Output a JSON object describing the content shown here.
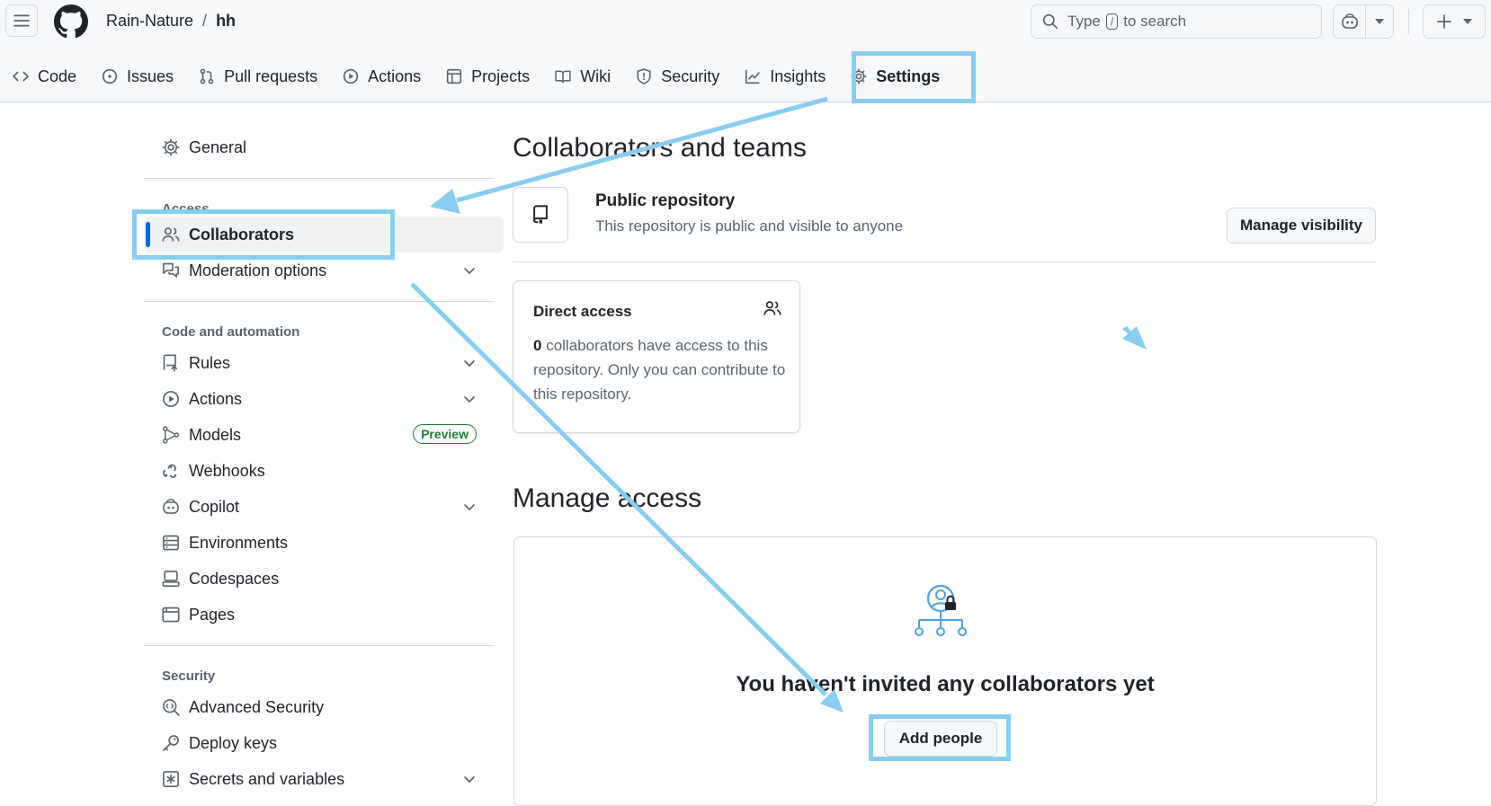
{
  "header": {
    "owner": "Rain-Nature",
    "separator": "/",
    "repo": "hh",
    "search_prefix": "Type",
    "search_key": "/",
    "search_suffix": "to search"
  },
  "tabs": [
    {
      "label": "Code",
      "icon": "code-icon"
    },
    {
      "label": "Issues",
      "icon": "issue-opened-icon"
    },
    {
      "label": "Pull requests",
      "icon": "git-pull-request-icon"
    },
    {
      "label": "Actions",
      "icon": "play-icon"
    },
    {
      "label": "Projects",
      "icon": "table-icon"
    },
    {
      "label": "Wiki",
      "icon": "book-icon"
    },
    {
      "label": "Security",
      "icon": "shield-icon"
    },
    {
      "label": "Insights",
      "icon": "graph-icon"
    },
    {
      "label": "Settings",
      "icon": "gear-icon",
      "selected": true
    }
  ],
  "sidebar": {
    "general": "General",
    "access_heading": "Access",
    "collaborators": "Collaborators",
    "moderation": "Moderation options",
    "code_heading": "Code and automation",
    "rules": "Rules",
    "actions": "Actions",
    "models": "Models",
    "preview_badge": "Preview",
    "webhooks": "Webhooks",
    "copilot": "Copilot",
    "environments": "Environments",
    "codespaces": "Codespaces",
    "pages": "Pages",
    "security_heading": "Security",
    "advanced_security": "Advanced Security",
    "deploy_keys": "Deploy keys",
    "secrets": "Secrets and variables"
  },
  "main": {
    "title": "Collaborators and teams",
    "public_title": "Public repository",
    "public_desc": "This repository is public and visible to anyone",
    "manage_visibility": "Manage visibility",
    "direct_title": "Direct access",
    "direct_count": "0",
    "direct_text": " collaborators have access to this repository. Only you can contribute to this repository.",
    "manage_title": "Manage access",
    "empty_msg": "You haven't invited any collaborators yet",
    "add_people": "Add people"
  },
  "colors": {
    "annotation": "#87cdf1",
    "accent": "#0969da",
    "preview": "#1a7f37"
  }
}
